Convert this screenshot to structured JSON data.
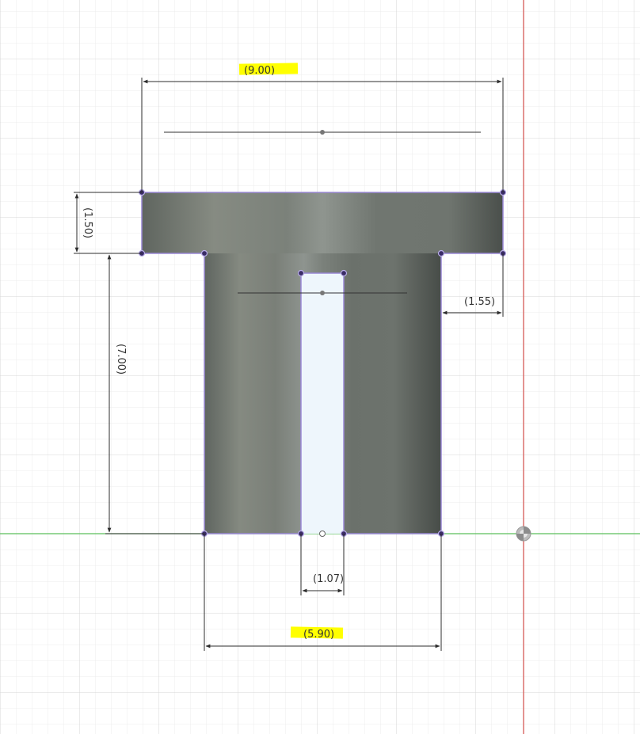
{
  "colors": {
    "background": "#ffffff",
    "grid_minor": "#ececec",
    "grid_major": "#d7d7d7",
    "axis_x": "#5bbf5b",
    "axis_y": "#d9534f",
    "body_profile": "#9a88d6",
    "dimension_line": "#2d2d2d",
    "highlight": "#ffff00",
    "slot_fill": "#eef6fc"
  },
  "dimensions": {
    "overall_width": "(9.00)",
    "flange_height": "(1.50)",
    "shaft_height": "(7.00)",
    "flange_overhang": "(1.55)",
    "slot_width": "(1.07)",
    "shaft_width": "(5.90)"
  },
  "highlighted_dimensions": [
    "overall_width",
    "shaft_width"
  ],
  "icons": {
    "origin": "origin-icon"
  }
}
